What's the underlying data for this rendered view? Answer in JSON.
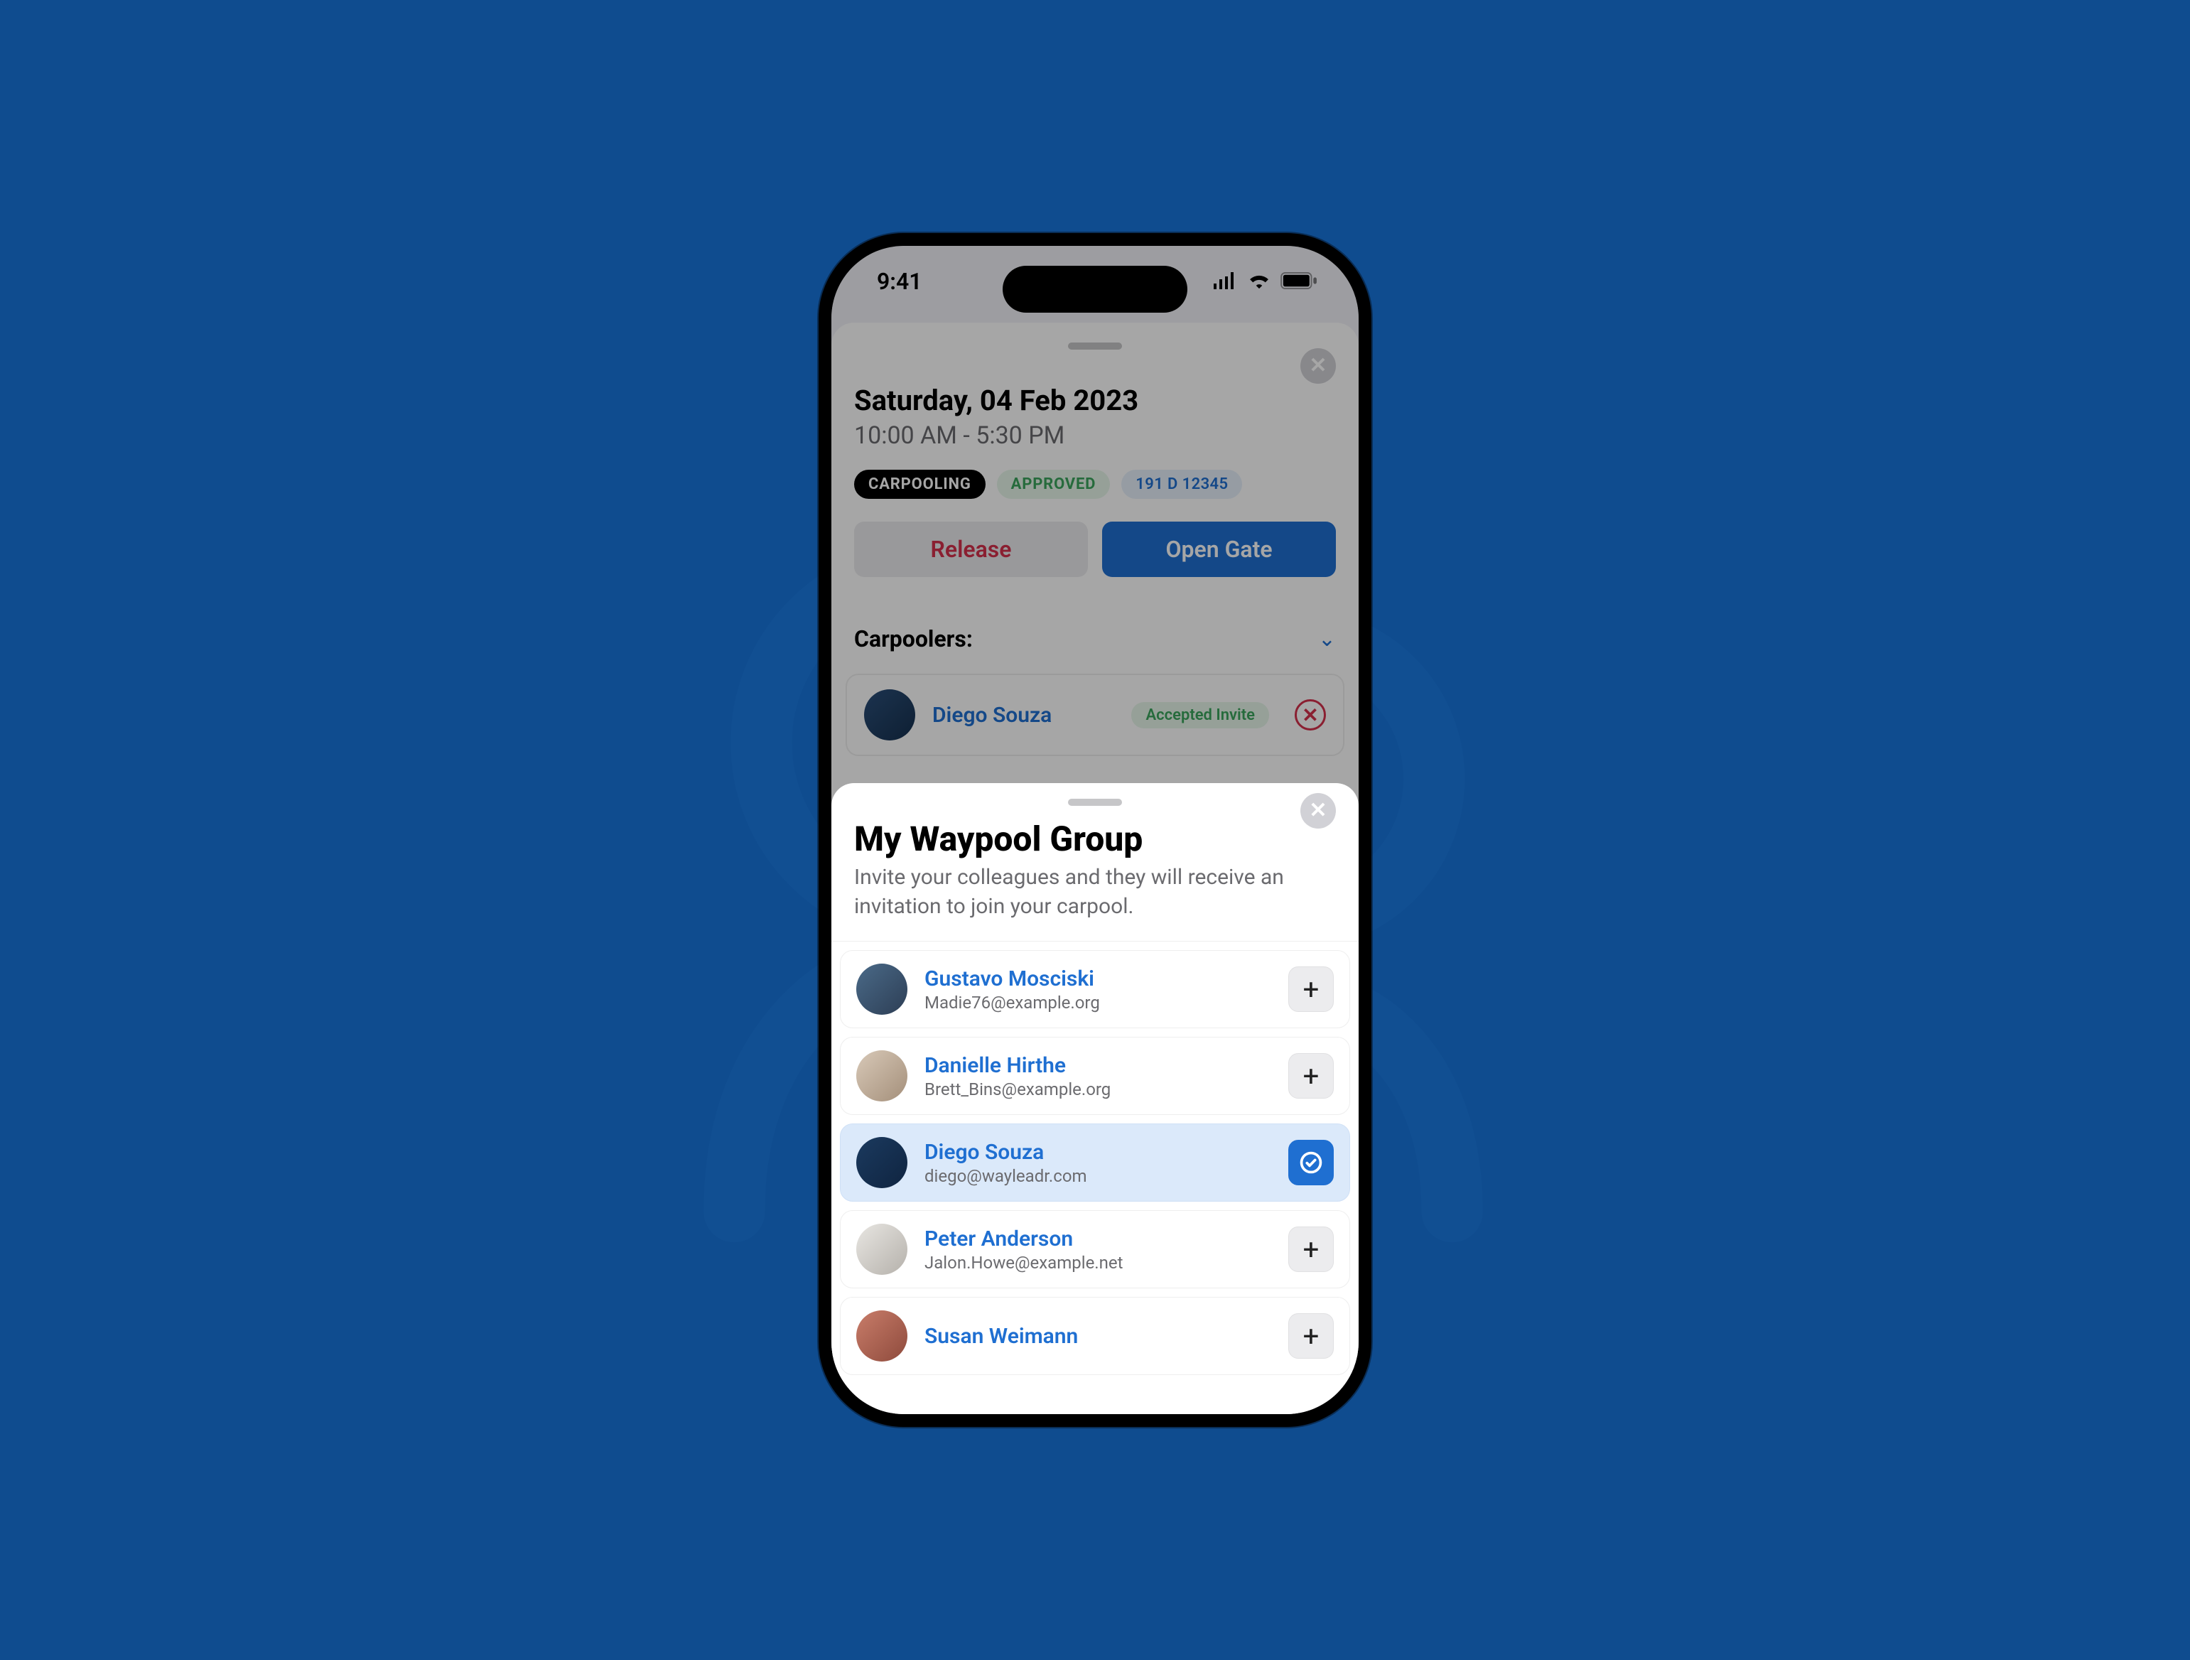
{
  "background": {
    "canvas_color": "#0F4C8F",
    "figure_icon": "two-people-outline"
  },
  "device": {
    "type": "phone-mock",
    "status_time": "9:41"
  },
  "parking_sheet": {
    "date_title": "Saturday, 04 Feb 2023",
    "time_range": "10:00 AM - 5:30 PM",
    "badges": {
      "carpool": "CARPOOLING",
      "approved": "APPROVED",
      "plate": "191 D 12345"
    },
    "buttons": {
      "release": "Release",
      "open_gate": "Open Gate"
    },
    "carpoolers_header": "Carpoolers:",
    "carpoolers": [
      {
        "name": "Diego Souza",
        "status_pill": "Accepted Invite"
      }
    ]
  },
  "group_sheet": {
    "title": "My Waypool Group",
    "description": "Invite your colleagues and they will receive an invitation to join your carpool.",
    "contacts": [
      {
        "name": "Gustavo Mosciski",
        "email": "Madie76@example.org",
        "selected": false
      },
      {
        "name": "Danielle Hirthe",
        "email": "Brett_Bins@example.org",
        "selected": false
      },
      {
        "name": "Diego Souza",
        "email": "diego@wayleadr.com",
        "selected": true
      },
      {
        "name": "Peter Anderson",
        "email": "Jalon.Howe@example.net",
        "selected": false
      },
      {
        "name": "Susan Weimann",
        "email": "",
        "selected": false
      }
    ]
  }
}
